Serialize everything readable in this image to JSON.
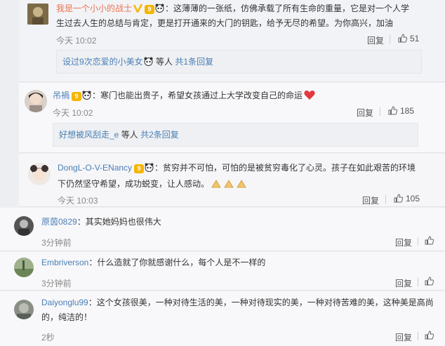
{
  "comments": [
    {
      "user": "我是一个小小的战士",
      "badge_v": "V",
      "badge_vip": "9",
      "text_line1": "：这薄薄的一张纸，仿佛承载了所有生命的重量，它是对一个人学",
      "text_line2": "生过去人生的总结与肯定，更是打开通来的大门的钥匙，给予无尽的希望。为你高兴，加油",
      "time": "今天 10:02",
      "reply": "回复",
      "likes": "51",
      "sub_user": "设过9次恋爱的小美女",
      "sub_mid": "等人",
      "sub_link": "共1条回复"
    },
    {
      "user": "吊禍",
      "badge_vip": "9",
      "text_line1": "：寒门也能出贵子，希望女孩通过上大学改变自己的命运",
      "time": "今天 10:02",
      "reply": "回复",
      "likes": "185",
      "sub_user": "好想被风刮走_e",
      "sub_mid": "等人",
      "sub_link": "共2条回复"
    },
    {
      "user": "DongL-O-V-ENancy",
      "badge_vip": "9",
      "text_line1": "：贫穷并不可怕，可怕的是被贫穷毒化了心灵。孩子在如此艰苦的环境",
      "text_line2": "下仍然坚守希望，成功蜕变，让人感动。",
      "time": "今天 10:03",
      "reply": "回复",
      "likes": "105"
    },
    {
      "user": "原茵0829",
      "text_line1": "：其实她妈妈也很伟大",
      "time": "3分钟前",
      "reply": "回复"
    },
    {
      "user": "Embriverson",
      "text_line1": "：什么造就了你就感谢什么，每个人是不一样的",
      "time": "3分钟前",
      "reply": "回复"
    },
    {
      "user": "Daiyonglu99",
      "text_line1": "：这个女孩很美，一种对待生活的美，一种对待现实的美，一种对待苦难的美，这种美是高尚",
      "text_line2": "的，纯洁的！",
      "time": "2秒",
      "reply": "回复"
    }
  ],
  "colors": {
    "username": "#eb7350",
    "link": "#4a7fb5",
    "background": "#eceef2"
  },
  "icons": [
    "avatar",
    "v-badge-icon",
    "vip-badge-icon",
    "panda-icon",
    "thumb-up-icon",
    "heart-emoji-icon",
    "clap-emoji-icon"
  ]
}
